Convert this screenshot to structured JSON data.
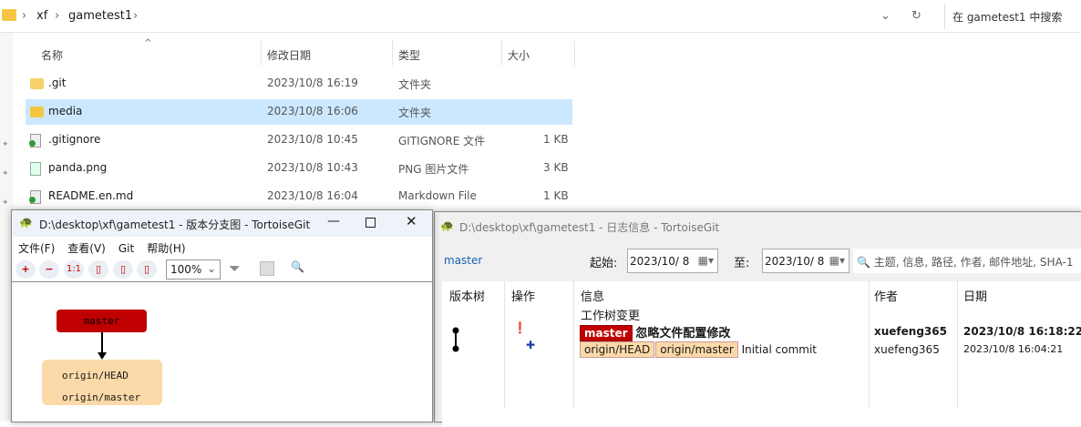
{
  "explorer": {
    "breadcrumb": [
      "xf",
      "gametest1"
    ],
    "search_placeholder": "在 gametest1 中搜索",
    "columns": [
      "名称",
      "修改日期",
      "类型",
      "大小"
    ],
    "files": [
      {
        "name": ".git",
        "date": "2023/10/8 16:19",
        "type": "文件夹",
        "size": ""
      },
      {
        "name": "media",
        "date": "2023/10/8 16:06",
        "type": "文件夹",
        "size": ""
      },
      {
        "name": ".gitignore",
        "date": "2023/10/8 10:45",
        "type": "GITIGNORE 文件",
        "size": "1 KB"
      },
      {
        "name": "panda.png",
        "date": "2023/10/8 10:43",
        "type": "PNG 图片文件",
        "size": "3 KB"
      },
      {
        "name": "README.en.md",
        "date": "2023/10/8 16:04",
        "type": "Markdown File",
        "size": "1 KB"
      }
    ]
  },
  "graph_window": {
    "title": "D:\\desktop\\xf\\gametest1 - 版本分支图 - TortoiseGit",
    "menu": [
      "文件(F)",
      "查看(V)",
      "Git",
      "帮助(H)"
    ],
    "toolbar": {
      "zoom_in": "+",
      "zoom_out": "−",
      "one_to_one": "1:1",
      "zoom": "100%"
    },
    "nodes": {
      "master": "master",
      "origin_head": "origin/HEAD",
      "origin_master": "origin/master"
    }
  },
  "log_window": {
    "title": "D:\\desktop\\xf\\gametest1 - 日志信息 - TortoiseGit",
    "branch": "master",
    "from_label": "起始:",
    "from_date": "2023/10/ 8",
    "to_label": "至:",
    "to_date": "2023/10/ 8",
    "filter_placeholder": "主题, 信息, 路径, 作者, 邮件地址, SHA-1",
    "columns": [
      "版本树",
      "操作",
      "信息",
      "作者",
      "日期"
    ],
    "working_tree": "工作树变更",
    "commits": [
      {
        "refs": [
          "master"
        ],
        "message": "忽略文件配置修改",
        "author": "xuefeng365",
        "date": "2023/10/8 16:18:22"
      },
      {
        "refs": [
          "origin/HEAD",
          "origin/master"
        ],
        "message": "Initial commit",
        "author": "xuefeng365",
        "date": "2023/10/8 16:04:21"
      }
    ]
  },
  "colors": {
    "master_tag": "#c00000",
    "remote_tag": "#fcd9a8",
    "selection": "#cce8ff"
  }
}
